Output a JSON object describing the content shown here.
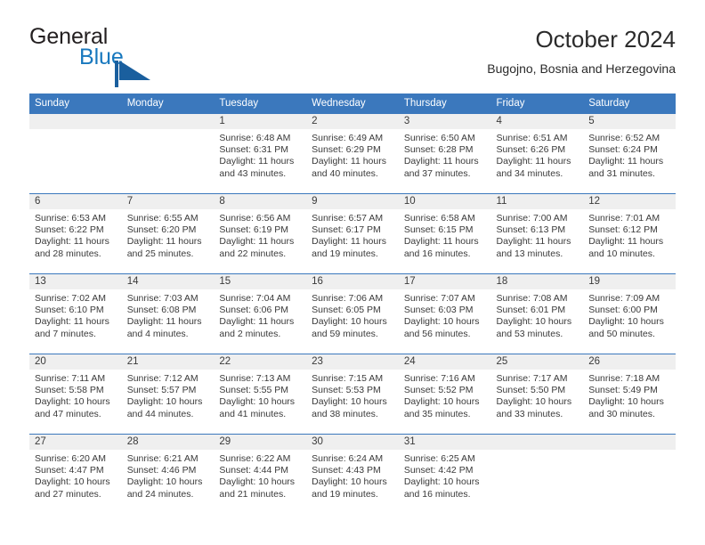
{
  "brand": {
    "line1": "General",
    "line2": "Blue",
    "logo_icon": "blue-flag-triangle-icon",
    "colors": {
      "dark_blue": "#1a5f9e",
      "link_blue": "#1878be",
      "text_dark": "#231f20"
    }
  },
  "header": {
    "title": "October 2024",
    "subtitle": "Bugojno, Bosnia and Herzegovina"
  },
  "calendar": {
    "accent_color": "#3b78bd",
    "daynum_band_color": "#efefef",
    "weekday_headers": [
      "Sunday",
      "Monday",
      "Tuesday",
      "Wednesday",
      "Thursday",
      "Friday",
      "Saturday"
    ],
    "weeks": [
      [
        {
          "day": "",
          "lines": []
        },
        {
          "day": "",
          "lines": []
        },
        {
          "day": "1",
          "lines": [
            "Sunrise: 6:48 AM",
            "Sunset: 6:31 PM",
            "Daylight: 11 hours",
            "and 43 minutes."
          ]
        },
        {
          "day": "2",
          "lines": [
            "Sunrise: 6:49 AM",
            "Sunset: 6:29 PM",
            "Daylight: 11 hours",
            "and 40 minutes."
          ]
        },
        {
          "day": "3",
          "lines": [
            "Sunrise: 6:50 AM",
            "Sunset: 6:28 PM",
            "Daylight: 11 hours",
            "and 37 minutes."
          ]
        },
        {
          "day": "4",
          "lines": [
            "Sunrise: 6:51 AM",
            "Sunset: 6:26 PM",
            "Daylight: 11 hours",
            "and 34 minutes."
          ]
        },
        {
          "day": "5",
          "lines": [
            "Sunrise: 6:52 AM",
            "Sunset: 6:24 PM",
            "Daylight: 11 hours",
            "and 31 minutes."
          ]
        }
      ],
      [
        {
          "day": "6",
          "lines": [
            "Sunrise: 6:53 AM",
            "Sunset: 6:22 PM",
            "Daylight: 11 hours",
            "and 28 minutes."
          ]
        },
        {
          "day": "7",
          "lines": [
            "Sunrise: 6:55 AM",
            "Sunset: 6:20 PM",
            "Daylight: 11 hours",
            "and 25 minutes."
          ]
        },
        {
          "day": "8",
          "lines": [
            "Sunrise: 6:56 AM",
            "Sunset: 6:19 PM",
            "Daylight: 11 hours",
            "and 22 minutes."
          ]
        },
        {
          "day": "9",
          "lines": [
            "Sunrise: 6:57 AM",
            "Sunset: 6:17 PM",
            "Daylight: 11 hours",
            "and 19 minutes."
          ]
        },
        {
          "day": "10",
          "lines": [
            "Sunrise: 6:58 AM",
            "Sunset: 6:15 PM",
            "Daylight: 11 hours",
            "and 16 minutes."
          ]
        },
        {
          "day": "11",
          "lines": [
            "Sunrise: 7:00 AM",
            "Sunset: 6:13 PM",
            "Daylight: 11 hours",
            "and 13 minutes."
          ]
        },
        {
          "day": "12",
          "lines": [
            "Sunrise: 7:01 AM",
            "Sunset: 6:12 PM",
            "Daylight: 11 hours",
            "and 10 minutes."
          ]
        }
      ],
      [
        {
          "day": "13",
          "lines": [
            "Sunrise: 7:02 AM",
            "Sunset: 6:10 PM",
            "Daylight: 11 hours",
            "and 7 minutes."
          ]
        },
        {
          "day": "14",
          "lines": [
            "Sunrise: 7:03 AM",
            "Sunset: 6:08 PM",
            "Daylight: 11 hours",
            "and 4 minutes."
          ]
        },
        {
          "day": "15",
          "lines": [
            "Sunrise: 7:04 AM",
            "Sunset: 6:06 PM",
            "Daylight: 11 hours",
            "and 2 minutes."
          ]
        },
        {
          "day": "16",
          "lines": [
            "Sunrise: 7:06 AM",
            "Sunset: 6:05 PM",
            "Daylight: 10 hours",
            "and 59 minutes."
          ]
        },
        {
          "day": "17",
          "lines": [
            "Sunrise: 7:07 AM",
            "Sunset: 6:03 PM",
            "Daylight: 10 hours",
            "and 56 minutes."
          ]
        },
        {
          "day": "18",
          "lines": [
            "Sunrise: 7:08 AM",
            "Sunset: 6:01 PM",
            "Daylight: 10 hours",
            "and 53 minutes."
          ]
        },
        {
          "day": "19",
          "lines": [
            "Sunrise: 7:09 AM",
            "Sunset: 6:00 PM",
            "Daylight: 10 hours",
            "and 50 minutes."
          ]
        }
      ],
      [
        {
          "day": "20",
          "lines": [
            "Sunrise: 7:11 AM",
            "Sunset: 5:58 PM",
            "Daylight: 10 hours",
            "and 47 minutes."
          ]
        },
        {
          "day": "21",
          "lines": [
            "Sunrise: 7:12 AM",
            "Sunset: 5:57 PM",
            "Daylight: 10 hours",
            "and 44 minutes."
          ]
        },
        {
          "day": "22",
          "lines": [
            "Sunrise: 7:13 AM",
            "Sunset: 5:55 PM",
            "Daylight: 10 hours",
            "and 41 minutes."
          ]
        },
        {
          "day": "23",
          "lines": [
            "Sunrise: 7:15 AM",
            "Sunset: 5:53 PM",
            "Daylight: 10 hours",
            "and 38 minutes."
          ]
        },
        {
          "day": "24",
          "lines": [
            "Sunrise: 7:16 AM",
            "Sunset: 5:52 PM",
            "Daylight: 10 hours",
            "and 35 minutes."
          ]
        },
        {
          "day": "25",
          "lines": [
            "Sunrise: 7:17 AM",
            "Sunset: 5:50 PM",
            "Daylight: 10 hours",
            "and 33 minutes."
          ]
        },
        {
          "day": "26",
          "lines": [
            "Sunrise: 7:18 AM",
            "Sunset: 5:49 PM",
            "Daylight: 10 hours",
            "and 30 minutes."
          ]
        }
      ],
      [
        {
          "day": "27",
          "lines": [
            "Sunrise: 6:20 AM",
            "Sunset: 4:47 PM",
            "Daylight: 10 hours",
            "and 27 minutes."
          ]
        },
        {
          "day": "28",
          "lines": [
            "Sunrise: 6:21 AM",
            "Sunset: 4:46 PM",
            "Daylight: 10 hours",
            "and 24 minutes."
          ]
        },
        {
          "day": "29",
          "lines": [
            "Sunrise: 6:22 AM",
            "Sunset: 4:44 PM",
            "Daylight: 10 hours",
            "and 21 minutes."
          ]
        },
        {
          "day": "30",
          "lines": [
            "Sunrise: 6:24 AM",
            "Sunset: 4:43 PM",
            "Daylight: 10 hours",
            "and 19 minutes."
          ]
        },
        {
          "day": "31",
          "lines": [
            "Sunrise: 6:25 AM",
            "Sunset: 4:42 PM",
            "Daylight: 10 hours",
            "and 16 minutes."
          ]
        },
        {
          "day": "",
          "lines": []
        },
        {
          "day": "",
          "lines": []
        }
      ]
    ]
  }
}
